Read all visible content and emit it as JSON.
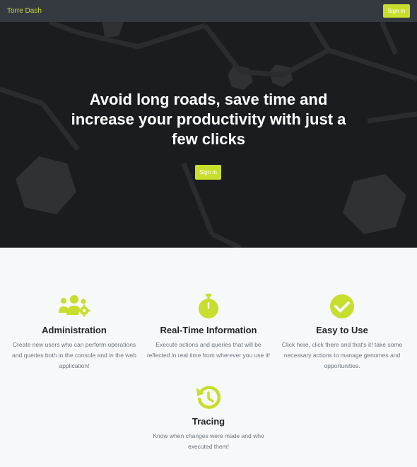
{
  "nav": {
    "brand": "Torre Dash",
    "signin": "Sign In"
  },
  "hero": {
    "title": "Avoid long roads, save time and increase your productivity with just a few clicks",
    "signin": "Sign In"
  },
  "features": [
    {
      "icon": "users-cog-icon",
      "title": "Administration",
      "text": "Create new users who can perform operations and queries both in the console and in the web application!"
    },
    {
      "icon": "stopwatch-icon",
      "title": "Real-Time Information",
      "text": "Execute actions and queries that will be reflected in real time from wherever you use it!"
    },
    {
      "icon": "check-circle-icon",
      "title": "Easy to Use",
      "text": "Click here, click there and that's it! take some necessary actions to manage genomes and opportunities."
    },
    {
      "icon": "history-icon",
      "title": "Tracing",
      "text": "Know when changes were made and who executed them!"
    }
  ],
  "colors": {
    "accent": "#c8de2c",
    "navbar": "#343a40",
    "hero": "#1a1c1f"
  }
}
